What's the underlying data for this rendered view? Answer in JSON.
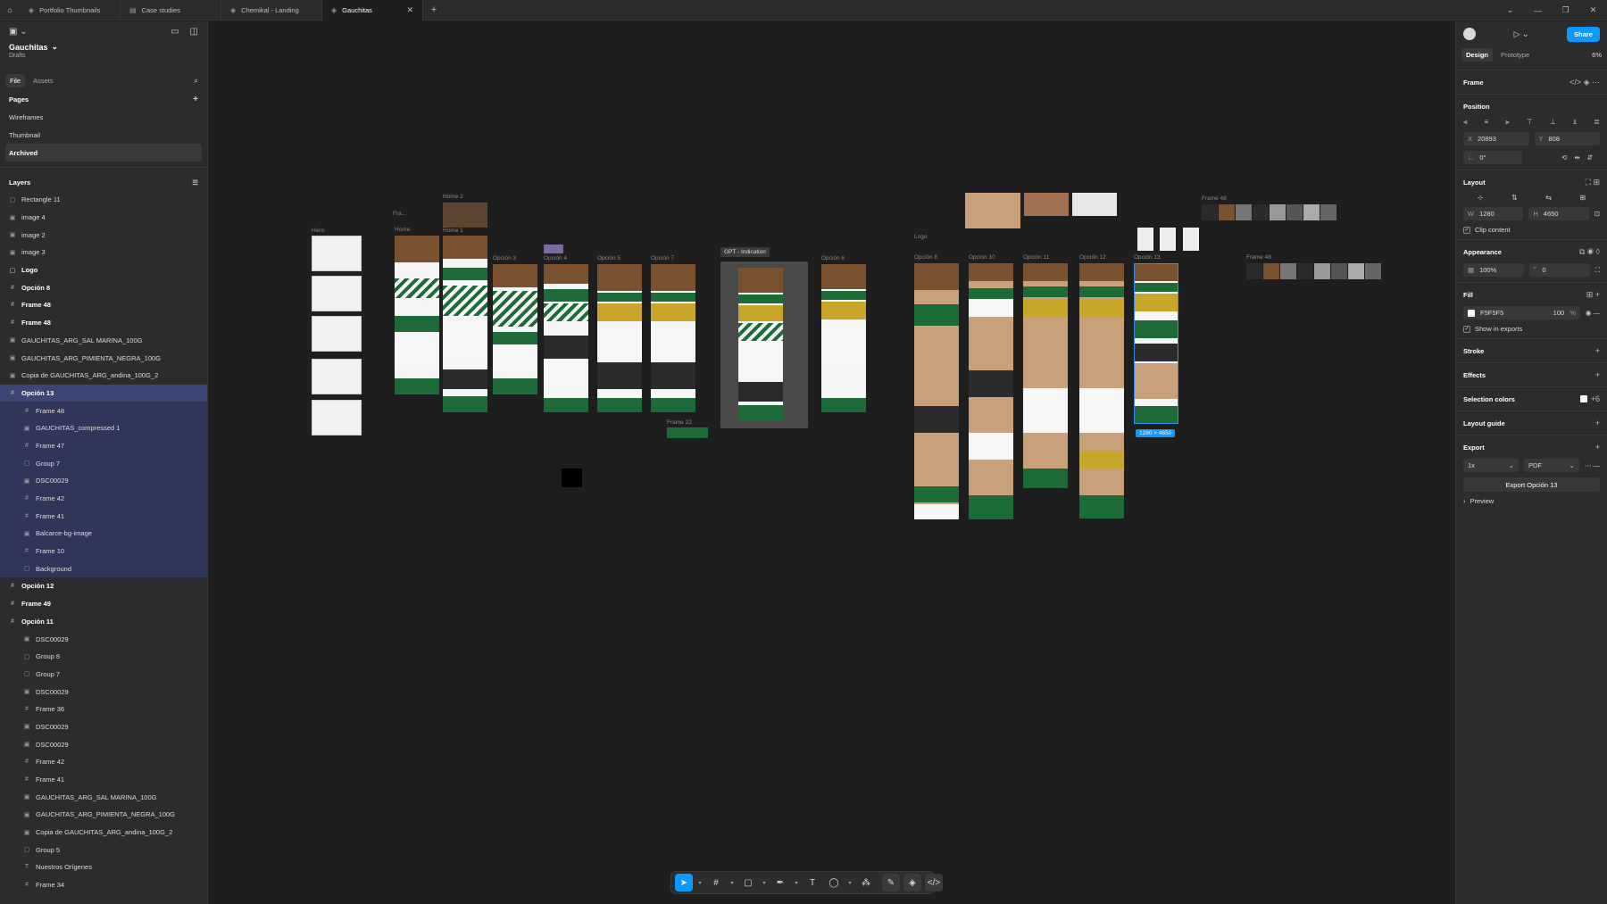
{
  "tabs": [
    {
      "label": "Portfolio Thumbnails",
      "active": false
    },
    {
      "label": "Case studies",
      "active": false
    },
    {
      "label": "Chemikal - Landing",
      "active": false
    },
    {
      "label": "Gauchitas",
      "active": true
    }
  ],
  "file": {
    "name": "Gauchitas",
    "location": "Drafts"
  },
  "left_tabs": {
    "file": "File",
    "assets": "Assets"
  },
  "pages": {
    "heading": "Pages",
    "items": [
      "Wireframes",
      "Thumbnail",
      "Archived"
    ],
    "selected": "Archived"
  },
  "layers": {
    "heading": "Layers",
    "items": [
      "Rectangle 11",
      "image 4",
      "image 2",
      "image 3",
      "Logo",
      "Opción 8",
      "Frame 48",
      "Frame 48",
      "GAUCHITAS_ARG_SAL MARINA_100G",
      "GAUCHITAS_ARG_PIMIENTA_NEGRA_100G",
      "Copia de GAUCHITAS_ARG_andina_100G_2",
      "Opción 13",
      "Frame 48",
      "GAUCHITAS_compressed 1",
      "Frame 47",
      "Group 7",
      "DSC00029",
      "Frame 42",
      "Frame 41",
      "Balcarce-bg-image",
      "Frame 10",
      "Background",
      "Opción 12",
      "Frame 49",
      "Opción 11",
      "DSC00029",
      "Group 8",
      "Group 7",
      "DSC00029",
      "Frame 36",
      "DSC00029",
      "DSC00029",
      "Frame 42",
      "Frame 41",
      "GAUCHITAS_ARG_SAL MARINA_100G",
      "GAUCHITAS_ARG_PIMIENTA_NEGRA_100G",
      "Copia de GAUCHITAS_ARG_andina_100G_2",
      "Group 5",
      "Nuestros Orígenes",
      "Frame 34"
    ]
  },
  "canvas_labels": {
    "hero": "Hero",
    "fra": "Fra...",
    "home": "Home",
    "home2": "Home 2",
    "home1": "Home 1",
    "op3": "Opción 3",
    "op4": "Opción 4",
    "op5": "Opción 5",
    "op7": "Opción 7",
    "gpt": "GPT - Indication",
    "op6": "Opción 6",
    "logo": "Logo",
    "op8": "Opción 8",
    "op10": "Opción 10",
    "op11": "Opción 11",
    "op12": "Opción 12",
    "op13": "Opción 13",
    "frame48a": "Frame 48",
    "frame48b": "Frame 48",
    "frame22": "Frame 22",
    "size": "1280 × 4650"
  },
  "right": {
    "share": "Share",
    "tabs": {
      "design": "Design",
      "prototype": "Prototype"
    },
    "zoom": "6%",
    "frame_type": "Frame",
    "position": {
      "heading": "Position",
      "x_label": "X",
      "x": "20893",
      "y_label": "Y",
      "y": "808",
      "rotation": "0°"
    },
    "layout": {
      "heading": "Layout",
      "w_label": "W",
      "w": "1280",
      "h_label": "H",
      "h": "4650",
      "clip": "Clip content"
    },
    "appearance": {
      "heading": "Appearance",
      "opacity": "100%",
      "radius": "0"
    },
    "fill": {
      "heading": "Fill",
      "hex": "F5F5F5",
      "opacity": "100",
      "unit": "%",
      "show_exports": "Show in exports"
    },
    "stroke": "Stroke",
    "effects": "Effects",
    "selection_colors": {
      "heading": "Selection colors",
      "more": "+6"
    },
    "layout_guide": "Layout guide",
    "export": {
      "heading": "Export",
      "scale": "1x",
      "format": "PDF",
      "button": "Export Opción 13",
      "preview": "Preview"
    }
  },
  "colors": {
    "accent": "#0d99ff",
    "selection": "#3c4674",
    "brand_green": "#1e6b3a",
    "brand_yellow": "#c8a62a"
  },
  "help": "?"
}
